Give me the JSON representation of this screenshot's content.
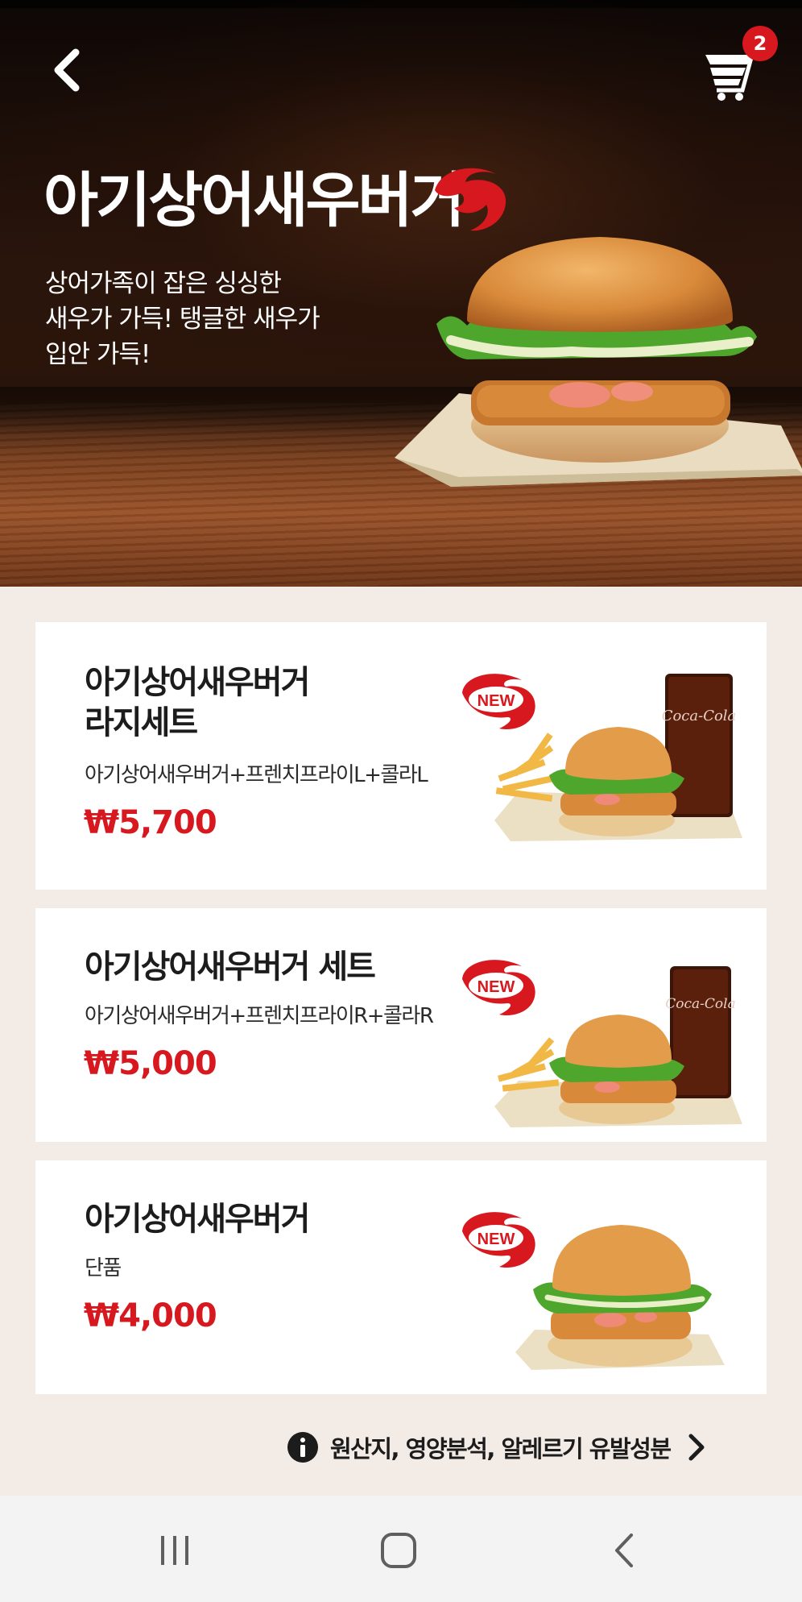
{
  "header": {
    "back_icon": "chevron-left-icon",
    "cart_icon": "shopping-cart-icon",
    "cart_count": "2"
  },
  "hero": {
    "title": "아기상어새우버거",
    "description_lines": [
      "상어가족이 잡은 싱싱한",
      "새우가 가득! 탱글한 새우가",
      "입안 가득!"
    ]
  },
  "menu_items": [
    {
      "name_lines": [
        "아기상어새우버거",
        "라지세트"
      ],
      "description": "아기상어새우버거+프렌치프라이L+콜라L",
      "price": "₩5,700",
      "badge": "NEW"
    },
    {
      "name_lines": [
        "아기상어새우버거 세트"
      ],
      "description": "아기상어새우버거+프렌치프라이R+콜라R",
      "price": "₩5,000",
      "badge": "NEW"
    },
    {
      "name_lines": [
        "아기상어새우버거"
      ],
      "description": "단품",
      "price": "₩4,000",
      "badge": "NEW"
    }
  ],
  "info_link": {
    "icon": "info-icon",
    "label": "원산지, 영양분석, 알레르기 유발성분"
  },
  "system_nav": {
    "recents_icon": "recents-icon",
    "home_icon": "home-icon",
    "back_icon": "back-icon"
  },
  "colors": {
    "brand_red": "#d7181f",
    "page_bg": "#f2ebe6",
    "card_bg": "#ffffff"
  }
}
